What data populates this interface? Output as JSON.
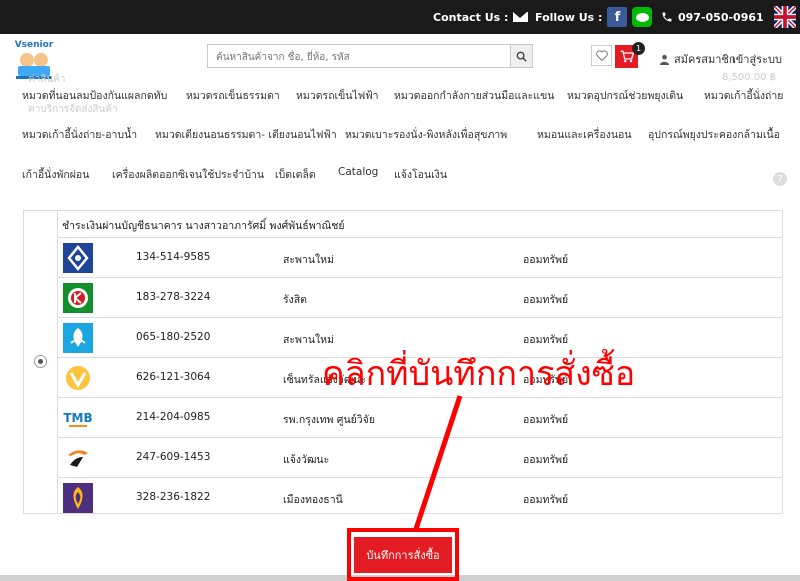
{
  "topbar": {
    "contact_label": "Contact Us :",
    "follow_label": "Follow Us :",
    "facebook_glyph": "f",
    "phone": "097-050-0961"
  },
  "header": {
    "logo_text": "Vsenior",
    "search_placeholder": "ค้นหาสินค้าจาก ชื่อ, ยี่ห้อ, รหัส",
    "cart_count": "1",
    "register_label": "สมัครสมาชิก",
    "login_label": "เข้าสู่ระบบ"
  },
  "background_ghost": {
    "line1": "ค่าสินค้า",
    "line2": "ค่าบริการจัดส่งสินค้า",
    "amount": "8,500.00 ฿"
  },
  "menu": {
    "row1": [
      "หมวดที่นอนลมป้องกันแผลกดทับ",
      "หมวดรถเข็นธรรมดา",
      "หมวดรถเข็นไฟฟ้า",
      "หมวดออกกำลังกายส่วนมือและแขน",
      "หมวดอุปกรณ์ช่วยพยุงเดิน",
      "หมวดเก้าอี้นั่งถ่าย"
    ],
    "row2": [
      "หมวดเก้าอี้นั่งถ่าย-อาบน้ำ",
      "หมวดเตียงนอนธรรมดา- เตียงนอนไฟฟ้า",
      "หมวดเบาะรองนั่ง-พิงหลังเพื่อสุขภาพ",
      "หมอนและเครื่องนอน",
      "อุปกรณ์พยุงประคองกล้ามเนื้อ"
    ],
    "row3": [
      "เก้าอี้นั่งพักผ่อน",
      "เครื่องผลิตออกซิเจนใช้ประจำบ้าน",
      "เบ็ดเตล็ด",
      "Catalog",
      "แจ้งโอนเงิน"
    ]
  },
  "payment": {
    "title": "ชำระเงินผ่านบัญชีธนาคาร นางสาวอาภารัศมิ์ พงศ์พันธ์พาณิชย์",
    "banks": [
      {
        "account": "134-514-9585",
        "branch": "สะพานใหม่",
        "type": "ออมทรัพย์",
        "icon": "bbl-bank-icon",
        "color": "#1e4598"
      },
      {
        "account": "183-278-3224",
        "branch": "รังสิต",
        "type": "ออมทรัพย์",
        "icon": "kbank-icon",
        "color": "#138f2d"
      },
      {
        "account": "065-180-2520",
        "branch": "สะพานใหม่",
        "type": "ออมทรัพย์",
        "icon": "ktb-bank-icon",
        "color": "#1ba5e1"
      },
      {
        "account": "626-121-3064",
        "branch": "เซ็นทรัลแจ้งวัฒนะ",
        "type": "ออมทรัพย์",
        "icon": "krungsri-bank-icon",
        "color": "#fec43b"
      },
      {
        "account": "214-204-0985",
        "branch": "รพ.กรุงเทพ ศูนย์วิจัย",
        "type": "ออมทรัพย์",
        "icon": "tmb-bank-icon",
        "color": "#1279be"
      },
      {
        "account": "247-609-1453",
        "branch": "แจ้งวัฒนะ",
        "type": "ออมทรัพย์",
        "icon": "tbank-icon",
        "color": "#f58220"
      },
      {
        "account": "328-236-1822",
        "branch": "เมืองทองธานี",
        "type": "ออมทรัพย์",
        "icon": "scb-bank-icon",
        "color": "#4e2e7f"
      }
    ]
  },
  "annotation": {
    "text": "คลิกที่บันทึกการสั่งซื้อ",
    "color": "#ff0000"
  },
  "save_button": {
    "label": "บันทึกการสั่งซื้อ"
  },
  "colors": {
    "accent": "#e31c23",
    "topbar": "#1a1a1a"
  }
}
